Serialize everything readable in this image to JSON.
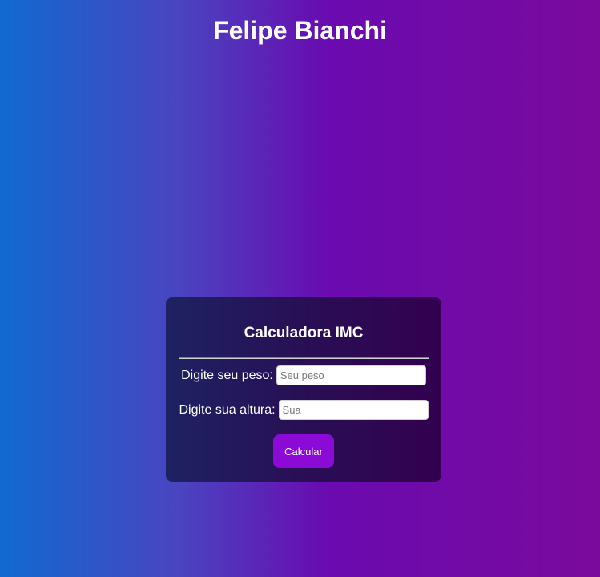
{
  "header": {
    "title": "Felipe Bianchi"
  },
  "calculator": {
    "title": "Calculadora IMC",
    "weight": {
      "label": "Digite seu peso:",
      "placeholder": "Seu peso",
      "value": ""
    },
    "height": {
      "label": "Digite sua altura:",
      "placeholder": "Sua",
      "value": ""
    },
    "button_label": "Calcular"
  },
  "colors": {
    "gradient_start": "#106ad0",
    "gradient_end": "#7a0a9c",
    "card_background": "#2a0d55",
    "button": "#8c0ad6",
    "text": "#ffffff"
  }
}
